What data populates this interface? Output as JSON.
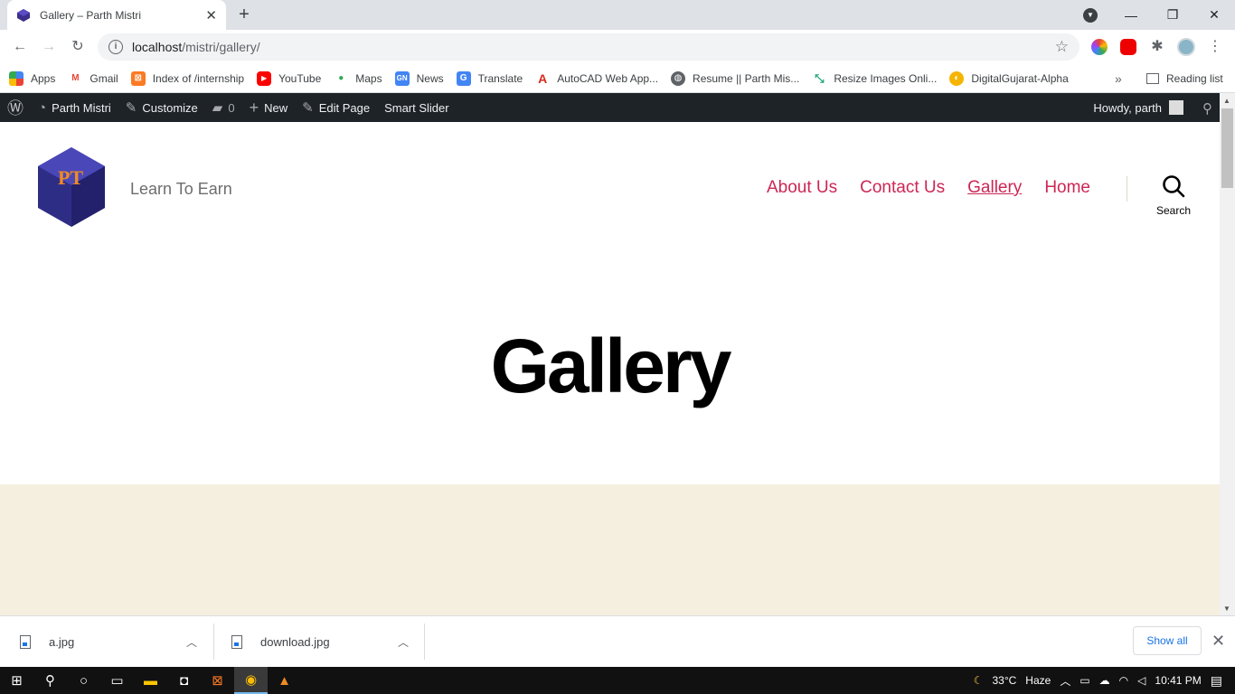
{
  "browser": {
    "tab_title": "Gallery – Parth Mistri",
    "new_tab": "+",
    "url_host": "localhost",
    "url_path": "/mistri/gallery/",
    "window_controls": {
      "minimize": "—",
      "restore": "❐",
      "close": "✕"
    }
  },
  "bookmarks": [
    {
      "label": "Apps",
      "icon": "apps-grid-icon",
      "color": "#4285f4"
    },
    {
      "label": "Gmail",
      "icon": "gmail-icon",
      "color": "#ea4335"
    },
    {
      "label": "Index of /internship",
      "icon": "xampp-icon",
      "color": "#fb7a24"
    },
    {
      "label": "YouTube",
      "icon": "youtube-icon",
      "color": "#ff0000"
    },
    {
      "label": "Maps",
      "icon": "maps-icon",
      "color": "#34a853"
    },
    {
      "label": "News",
      "icon": "news-icon",
      "color": "#4285f4"
    },
    {
      "label": "Translate",
      "icon": "translate-icon",
      "color": "#4285f4"
    },
    {
      "label": "AutoCAD Web App...",
      "icon": "autocad-icon",
      "color": "#d52b1e"
    },
    {
      "label": "Resume || Parth Mis...",
      "icon": "globe-icon",
      "color": "#5f6368"
    },
    {
      "label": "Resize Images Onli...",
      "icon": "resize-icon",
      "color": "#1fa67a"
    },
    {
      "label": "DigitalGujarat-Alpha",
      "icon": "digitalgujarat-icon",
      "color": "#f4b400"
    }
  ],
  "reading_list": "Reading list",
  "more_bookmarks": "»",
  "adminbar": {
    "site": "Parth Mistri",
    "customize": "Customize",
    "comments": "0",
    "new": "New",
    "edit_page": "Edit Page",
    "smart_slider": "Smart Slider",
    "howdy": "Howdy, parth"
  },
  "site": {
    "tagline": "Learn To Earn",
    "logo_text": "PT",
    "nav": [
      "About Us",
      "Contact Us",
      "Gallery",
      "Home"
    ],
    "search_label": "Search",
    "page_title": "Gallery"
  },
  "downloads": {
    "files": [
      "a.jpg",
      "download.jpg"
    ],
    "show_all": "Show all"
  },
  "taskbar": {
    "temperature": "33°C",
    "weather": "Haze",
    "time": "10:41 PM"
  },
  "colors": {
    "accent": "#cd2653",
    "adminbar_bg": "#1d2327",
    "beige": "#f5efe0"
  }
}
